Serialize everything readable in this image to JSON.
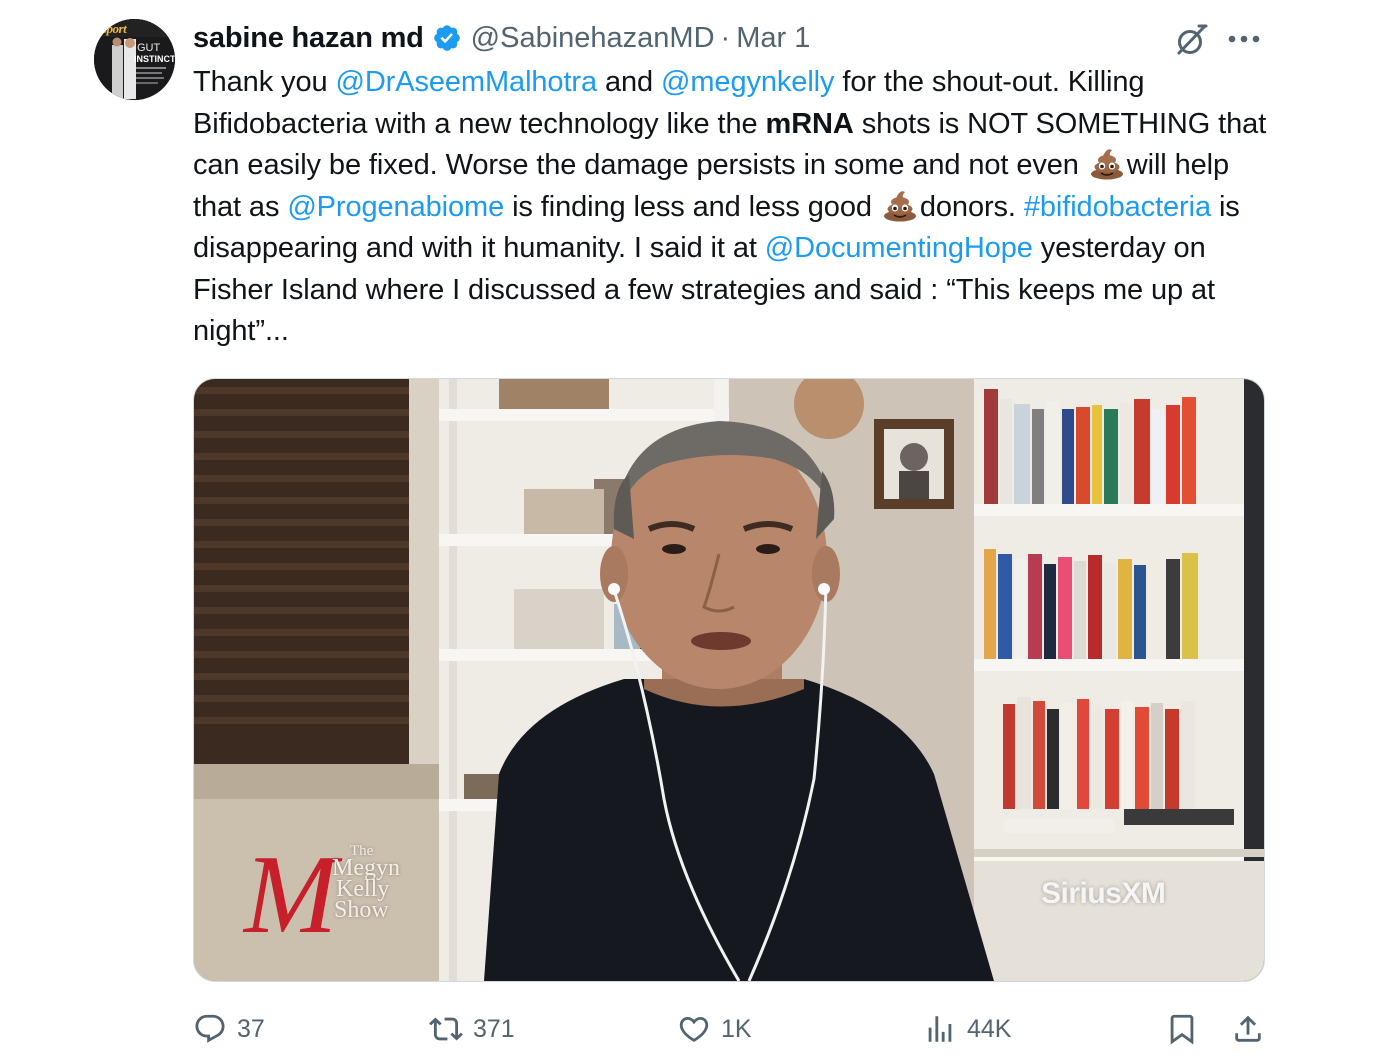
{
  "author": {
    "display_name": "sabine hazan md",
    "handle": "@SabinehazanMD",
    "separator": "·",
    "date": "Mar 1",
    "avatar_text": {
      "masthead": "sport",
      "cover_line1": "GUT",
      "cover_line2": "INSTINCT"
    }
  },
  "colors": {
    "link": "#1d9bf0",
    "verified": "#1d9bf0",
    "secondary_text": "#536471",
    "primary_text": "#0f1419"
  },
  "tweet": {
    "seg1": "Thank you ",
    "mention1": "@DrAseemMalhotra",
    "seg2": " and ",
    "mention2": "@megynkelly",
    "seg3": " for the shout-out. Killing Bifidobacteria with a new technology like the ",
    "bold1": "mRNA",
    "seg4": " shots is NOT SOMETHING that can easily be fixed. Worse the damage persists in some and not even ",
    "seg5": "will help that as ",
    "mention3": "@Progenabiome",
    "seg6": " is finding less and less good ",
    "seg7": "donors. ",
    "hashtag1": "#bifidobacteria",
    "seg8": " is disappearing and with it humanity. I said it at ",
    "mention4": "@DocumentingHope",
    "seg9": " yesterday on Fisher Island where I discussed a few strategies and said : “This keeps me up at night”..."
  },
  "media": {
    "show_logo_letter": "M",
    "show_logo_words": [
      "The",
      "Megyn",
      "Kelly",
      "Show"
    ],
    "network": "SiriusXM"
  },
  "actions": {
    "replies": "37",
    "reposts": "371",
    "likes": "1K",
    "views": "44K"
  },
  "icons": [
    "verified-badge-icon",
    "grok-icon",
    "more-icon",
    "reply-icon",
    "repost-icon",
    "like-icon",
    "views-icon",
    "bookmark-icon",
    "share-icon",
    "poop-emoji-icon"
  ]
}
